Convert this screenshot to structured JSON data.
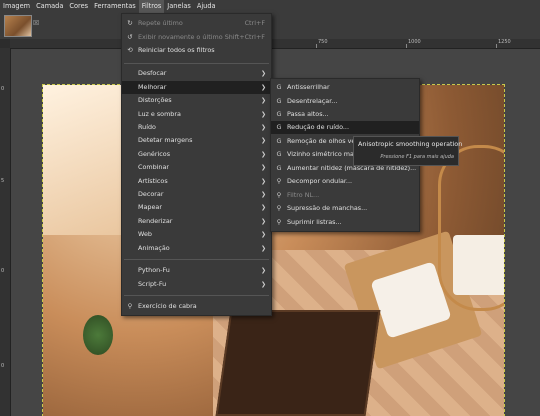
{
  "menubar": [
    "Imagem",
    "Camada",
    "Cores",
    "Ferramentas",
    "Filtros",
    "Janelas",
    "Ajuda"
  ],
  "ruler": {
    "h_labels": [
      "750",
      "1000",
      "1250"
    ],
    "v_labels": [
      "0",
      "5",
      "0",
      "0"
    ]
  },
  "filtros_menu": {
    "top": [
      {
        "label": "Repete último",
        "shortcut": "Ctrl+F",
        "disabled": true
      },
      {
        "label": "Exibir novamente o último",
        "shortcut": "Shift+Ctrl+F",
        "disabled": true
      },
      {
        "label": "Reiniciar todos os filtros",
        "shortcut": "",
        "disabled": false
      }
    ],
    "groups": [
      "Desfocar",
      "Melhorar",
      "Distorções",
      "Luz e sombra",
      "Ruído",
      "Detetar margens",
      "Genéricos",
      "Combinar",
      "Artísticos",
      "Decorar",
      "Mapear",
      "Renderizar",
      "Web",
      "Animação"
    ],
    "scripts": [
      "Python-Fu",
      "Script-Fu"
    ],
    "last": "Exercício de cabra"
  },
  "melhorar_menu": [
    {
      "label": "Antisserrilhar",
      "icon": "G"
    },
    {
      "label": "Desentrelaçar...",
      "icon": "G"
    },
    {
      "label": "Passa altos...",
      "icon": "G"
    },
    {
      "label": "Redução de ruído...",
      "icon": "G"
    },
    {
      "label": "Remoção de olhos vermelhos...",
      "icon": "G"
    },
    {
      "label": "Vizinho simétrico mais próximo...",
      "icon": "G"
    },
    {
      "label": "Aumentar nitidez (máscara de nitidez)...",
      "icon": "G"
    },
    {
      "label": "Decompor ondular...",
      "icon": "plugin"
    },
    {
      "label": "Filtro NL...",
      "icon": "plugin",
      "disabled": true
    },
    {
      "label": "Supressão de manchas...",
      "icon": "plugin"
    },
    {
      "label": "Suprimir listras...",
      "icon": "plugin"
    }
  ],
  "tooltip": {
    "title": "Anisotropic smoothing operation",
    "hint": "Pressione F1 para mais ajuda"
  },
  "colors": {
    "menu_bg": "#3a3a3a",
    "highlight": "#202020",
    "menubar_bg": "#3b3b3b"
  }
}
